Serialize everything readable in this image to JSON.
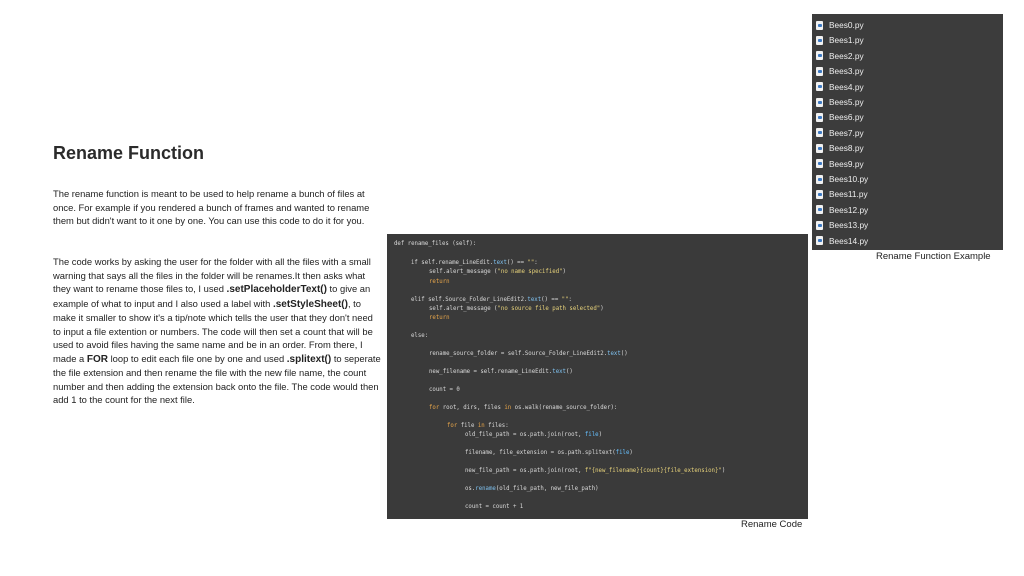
{
  "title": "Rename Function",
  "para1": "The rename function is meant to be used to help rename a bunch of files at once. For example if you rendered a bunch of frames and wanted to rename them but didn't want to it one by one. You can use this code to do it for you.",
  "para2": {
    "t1": "The code works by asking the user for the folder with all the files with a small warning that says all the files in the folder will be renames.It then asks what they want to rename those files to, I used ",
    "b1": ".setPlaceholderText()",
    "t2": " to give an example of what to input and I also used a label with ",
    "b2": ".setStyleSheet()",
    "t3": ", to make it smaller to show it's a tip/note which tells the user that they don't need to input a file extention or numbers.  The code will then set a count that will be used to avoid files having the same name and be in an order. From there, I made a ",
    "b3": "FOR",
    "t4": " loop to edit each file one by one and used ",
    "b4": ".splitext()",
    "t5": " to seperate the file extension and then rename the file with the new file name, the count number and then adding the extension back onto the file. The code would then add 1 to the count for the next file."
  },
  "code": {
    "l1": "def rename_files (self):",
    "l2a": "if self.rename_LineEdit.",
    "l2b": "text",
    "l2c": "() == ",
    "l2d": "\"\"",
    "l2e": ":",
    "l3a": "self.alert_message (",
    "l3b": "\"no name specified\"",
    "l3c": ")",
    "l4": "return",
    "l5a": "elif self.Source_Folder_LineEdit2.",
    "l5b": "text",
    "l5c": "() == ",
    "l5d": "\"\"",
    "l5e": ":",
    "l6a": "self.alert_message (",
    "l6b": "\"no source file path selected\"",
    "l6c": ")",
    "l7": "return",
    "l8": "else:",
    "l9a": "rename_source_folder = self.Source_Folder_LineEdit2.",
    "l9b": "text",
    "l9c": "()",
    "l10a": "new_filename = self.rename_LineEdit.",
    "l10b": "text",
    "l10c": "()",
    "l11": "count = 0",
    "l12a": "for",
    "l12b": " root, dirs, files ",
    "l12c": "in",
    "l12d": " os.walk(rename_source_folder):",
    "l13a": "for",
    "l13b": " file ",
    "l13c": "in",
    "l13d": " files:",
    "l14a": "old_file_path = os.path.join(root, ",
    "l14b": "file",
    "l14c": ")",
    "l15a": "filename, file_extension = os.path.splitext(",
    "l15b": "file",
    "l15c": ")",
    "l16a": "new_file_path = os.path.join(root, ",
    "l16b": "f\"{new_filename}{count}{file_extension}\"",
    "l16c": ")",
    "l17a": "os.",
    "l17b": "rename",
    "l17c": "(old_file_path, new_file_path)",
    "l18": "count = count + 1"
  },
  "code_caption": "Rename Code",
  "files": [
    "Bees0.py",
    "Bees1.py",
    "Bees2.py",
    "Bees3.py",
    "Bees4.py",
    "Bees5.py",
    "Bees6.py",
    "Bees7.py",
    "Bees8.py",
    "Bees9.py",
    "Bees10.py",
    "Bees11.py",
    "Bees12.py",
    "Bees13.py",
    "Bees14.py"
  ],
  "files_caption": "Rename Function Example",
  "colors": {
    "code_bg": "#3a3a3a",
    "file_panel_bg": "#3c3c3c",
    "keyword": "#e8a64a",
    "string": "#e7d27a",
    "function": "#7ec0ee"
  },
  "icons": {
    "file_entry": "python-file-icon"
  }
}
